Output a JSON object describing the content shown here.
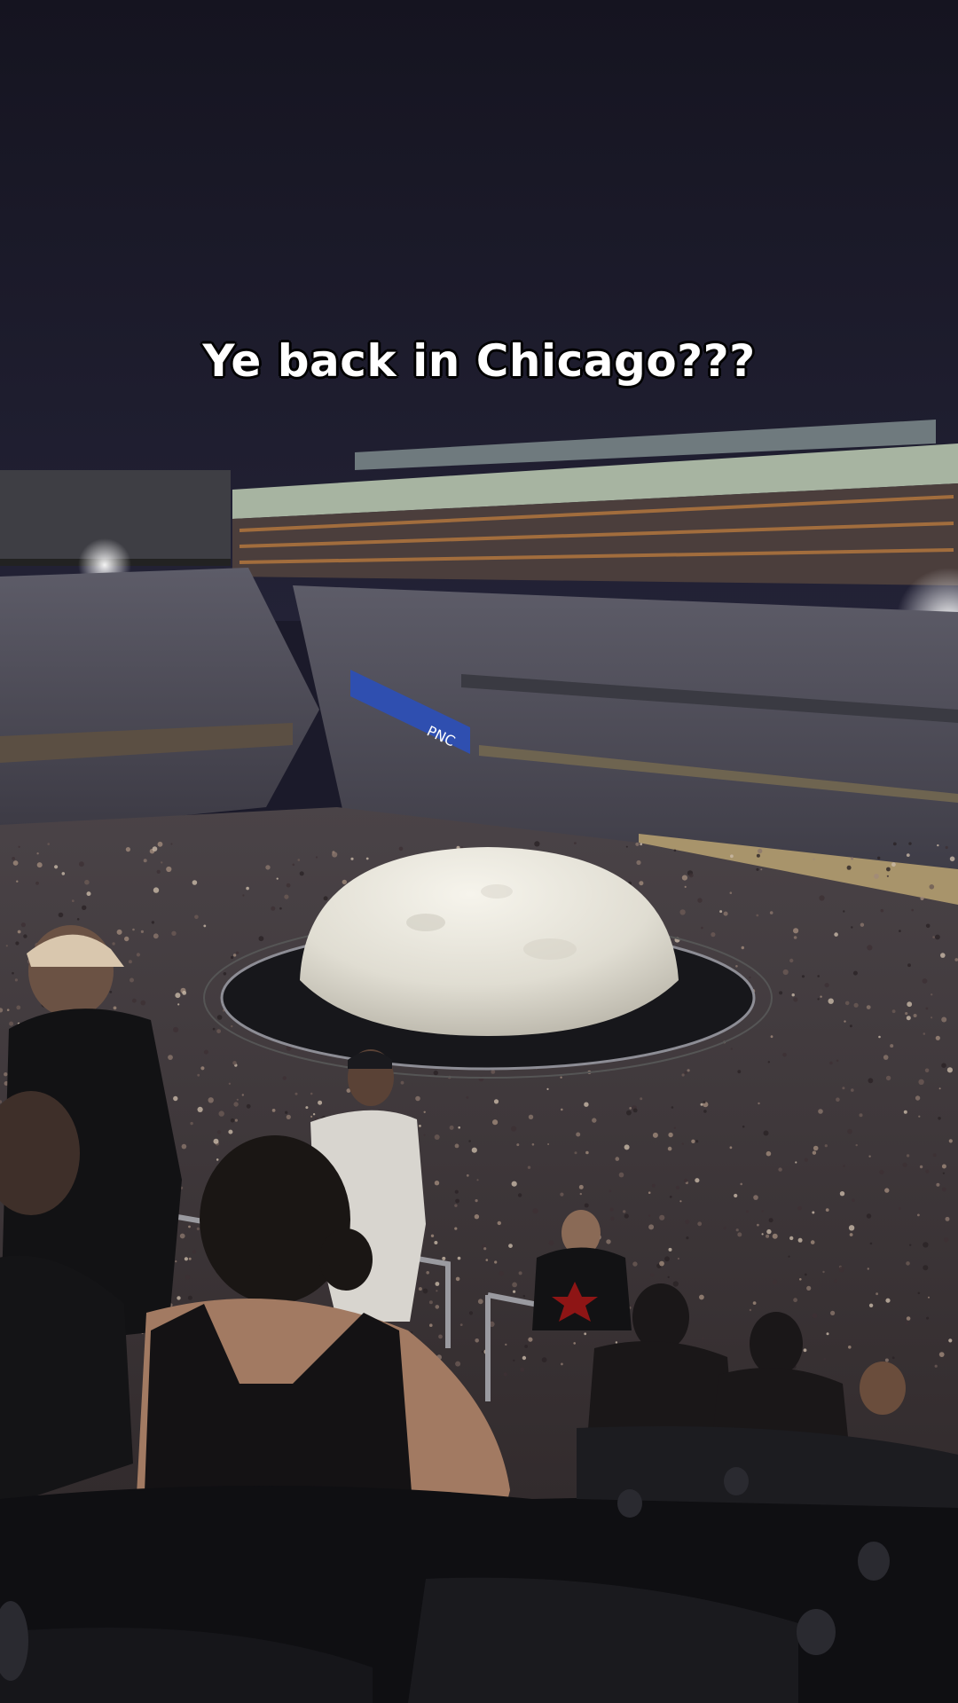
{
  "overlay": {
    "caption": "Ye back in Chicago???"
  },
  "scene": {
    "description_colors": {
      "sky": "#1c1b2c",
      "dome": "#e9e6dc",
      "stage": "#1c1c20",
      "crowd": "#3a2f2c"
    }
  },
  "banner": {
    "text": "PNC"
  }
}
